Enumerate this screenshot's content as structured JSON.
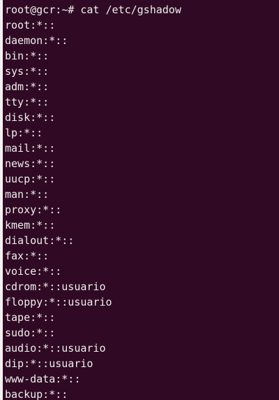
{
  "terminal": {
    "prompt": "root@gcr:~# cat /etc/gshadow",
    "lines": [
      "root:*::",
      "daemon:*::",
      "bin:*::",
      "sys:*::",
      "adm:*::",
      "tty:*::",
      "disk:*::",
      "lp:*::",
      "mail:*::",
      "news:*::",
      "uucp:*::",
      "man:*::",
      "proxy:*::",
      "kmem:*::",
      "dialout:*::",
      "fax:*::",
      "voice:*::",
      "cdrom:*::usuario",
      "floppy:*::usuario",
      "tape:*::",
      "sudo:*::",
      "audio:*::usuario",
      "dip:*::usuario",
      "www-data:*::",
      "backup:*::"
    ]
  },
  "colors": {
    "terminal_background": "#300a24",
    "terminal_text": "#eeeeec"
  }
}
